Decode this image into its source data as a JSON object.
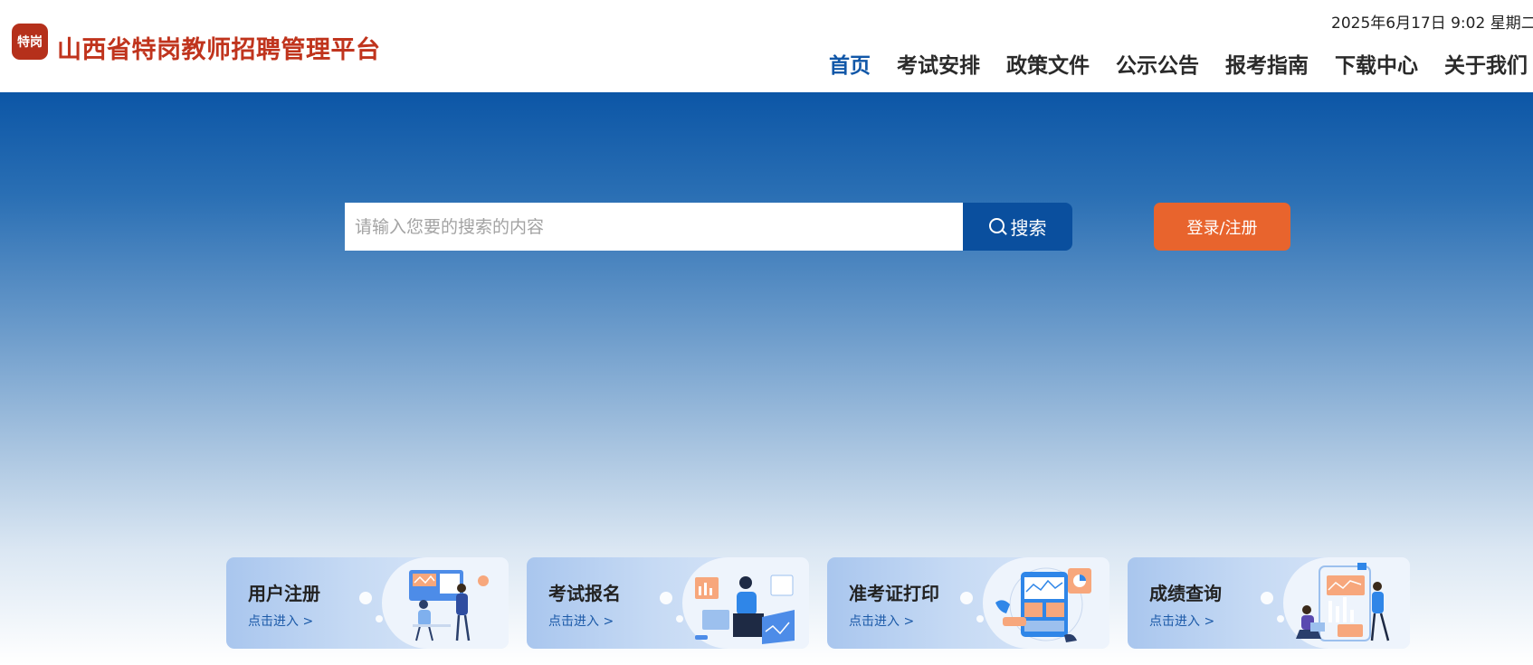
{
  "header": {
    "logo_text": "特岗",
    "site_title": "山西省特岗教师招聘管理平台",
    "datetime": "2025年6月17日 9:02 星期二"
  },
  "nav": {
    "items": [
      {
        "label": "首页",
        "active": true
      },
      {
        "label": "考试安排"
      },
      {
        "label": "政策文件"
      },
      {
        "label": "公示公告"
      },
      {
        "label": "报考指南"
      },
      {
        "label": "下载中心"
      },
      {
        "label": "关于我们"
      }
    ]
  },
  "search": {
    "placeholder": "请输入您要的搜索的内容",
    "button_label": "搜索"
  },
  "auth": {
    "login_label": "登录/注册"
  },
  "cards": [
    {
      "title": "用户注册",
      "link": "点击进入 >",
      "icon": "people-presentation-illustration"
    },
    {
      "title": "考试报名",
      "link": "点击进入 >",
      "icon": "woman-laptop-illustration"
    },
    {
      "title": "准考证打印",
      "link": "点击进入 >",
      "icon": "tablet-chart-illustration"
    },
    {
      "title": "成绩查询",
      "link": "点击进入 >",
      "icon": "people-phone-chart-illustration"
    }
  ],
  "colors": {
    "brand_red": "#c0341d",
    "nav_active": "#1157a8",
    "search_button": "#0a4f9e",
    "login_button": "#e8642d"
  }
}
